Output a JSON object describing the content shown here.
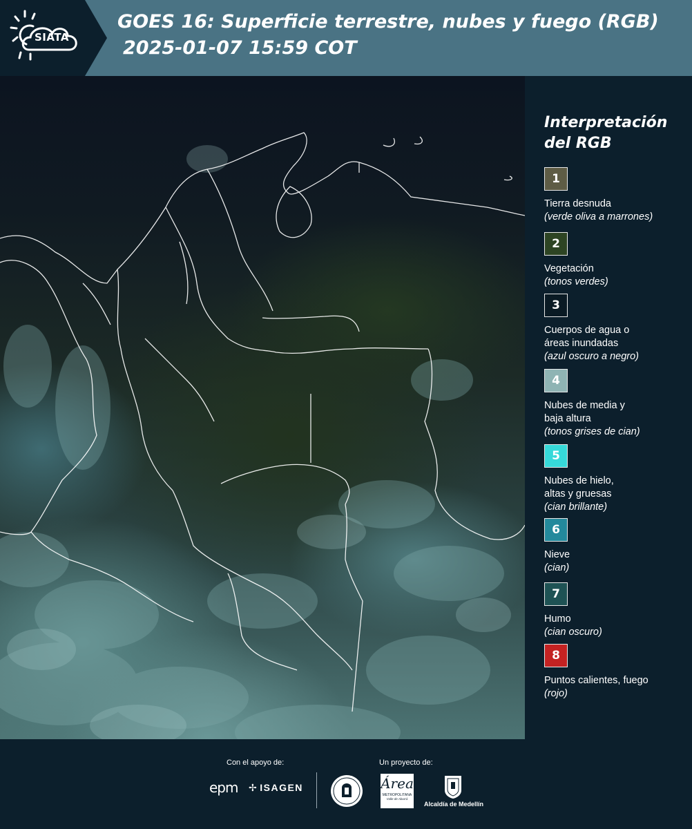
{
  "header": {
    "logo_text": "SIATA",
    "title": "GOES 16: Superficie terrestre, nubes y fuego (RGB)",
    "datetime": "2025-01-07 15:59 COT"
  },
  "legend": {
    "title_line1": "Interpretación",
    "title_line2": "del RGB",
    "items": [
      {
        "number": "1",
        "color": "#5e5c45",
        "line1": "Tierra desnuda",
        "line2": "",
        "note": "(verde oliva a marrones)"
      },
      {
        "number": "2",
        "color": "#2d4423",
        "line1": "Vegetación",
        "line2": "",
        "note": "(tonos verdes)"
      },
      {
        "number": "3",
        "color": "#0a1a24",
        "line1": "Cuerpos de agua o",
        "line2": "áreas inundadas",
        "note": "(azul oscuro a negro)"
      },
      {
        "number": "4",
        "color": "#8fb4b4",
        "line1": "Nubes de media y",
        "line2": "baja altura",
        "note": "(tonos grises de cian)"
      },
      {
        "number": "5",
        "color": "#36d9d9",
        "line1": "Nubes de hielo,",
        "line2": "altas y gruesas",
        "note": "(cian brillante)"
      },
      {
        "number": "6",
        "color": "#23899c",
        "line1": "Nieve",
        "line2": "",
        "note": "(cian)"
      },
      {
        "number": "7",
        "color": "#1e5254",
        "line1": "Humo",
        "line2": "",
        "note": "(cian oscuro)"
      },
      {
        "number": "8",
        "color": "#c42222",
        "line1": "Puntos calientes, fuego",
        "line2": "",
        "note": "(rojo)"
      }
    ]
  },
  "footer": {
    "support_label": "Con el apoyo de:",
    "project_label": "Un proyecto de:",
    "sponsors": [
      "epm",
      "ISAGEN"
    ],
    "area_logo_script": "Área",
    "area_logo_caption": "METROPOLITANA",
    "area_logo_caption2": "Valle de Aburrá",
    "alcaldia_label": "Alcaldía de Medellín"
  }
}
